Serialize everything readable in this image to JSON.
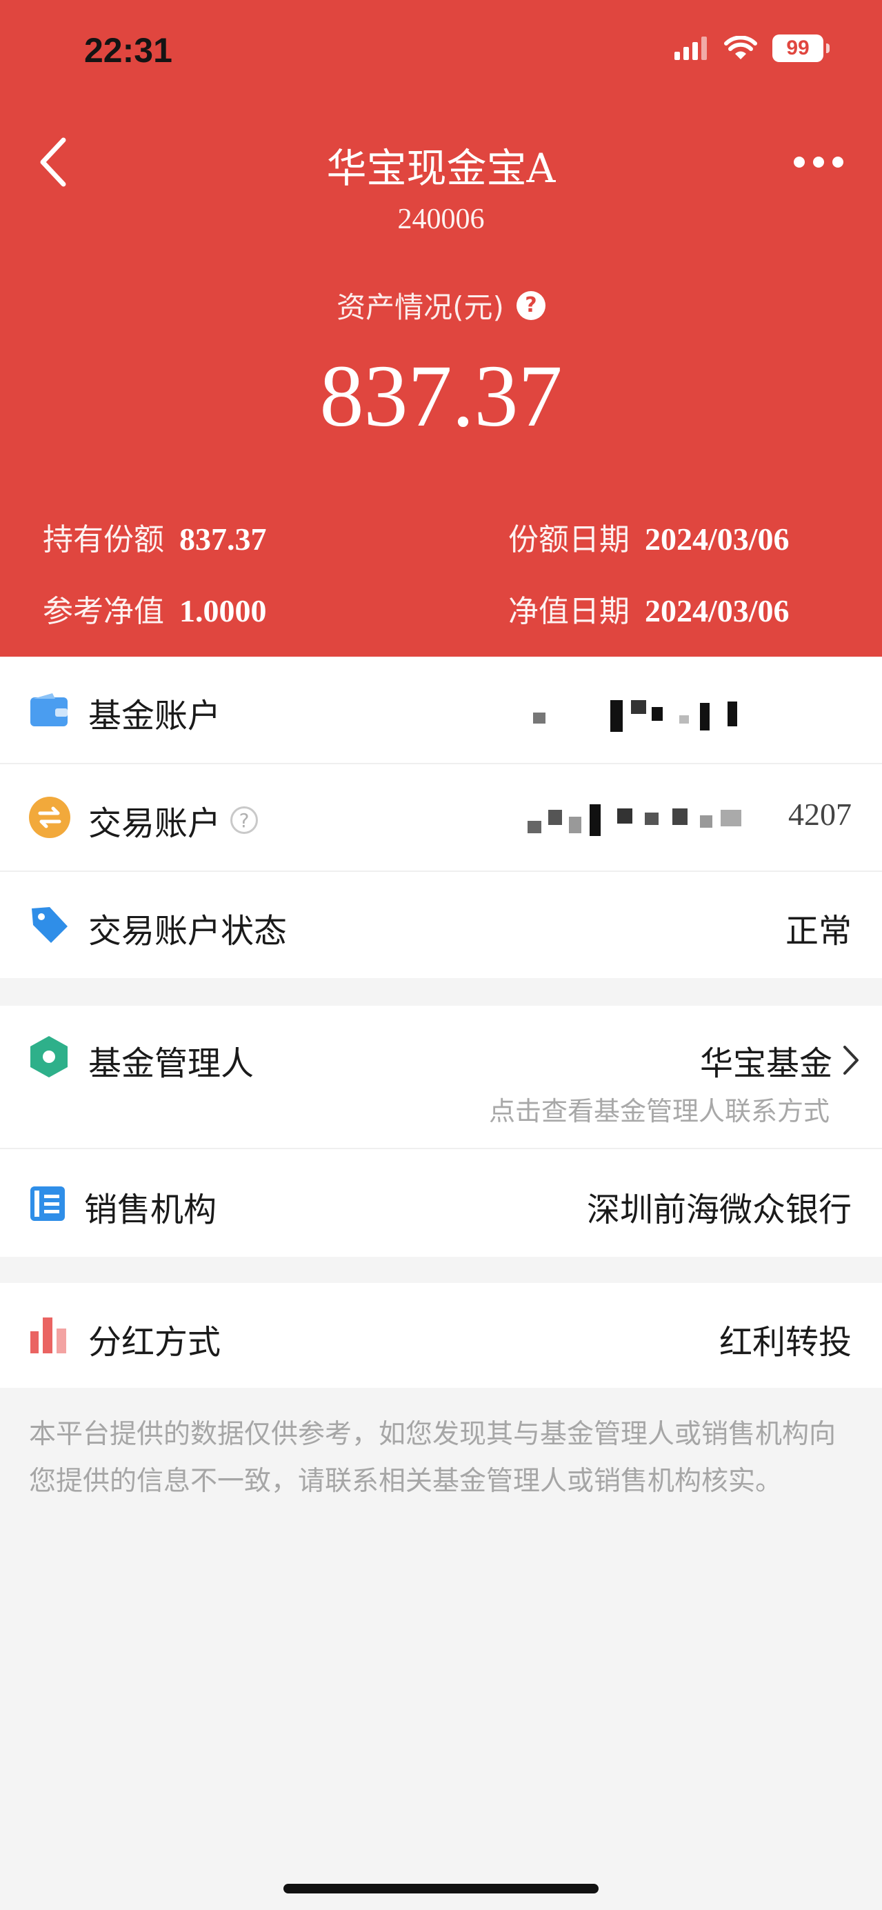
{
  "status_bar": {
    "time": "22:31",
    "battery": "99"
  },
  "header": {
    "fund_name": "华宝现金宝A",
    "fund_code": "240006",
    "asset_label": "资产情况(元)",
    "asset_value": "837.37",
    "stats": {
      "shares_label": "持有份额",
      "shares_value": "837.37",
      "shares_date_label": "份额日期",
      "shares_date_value": "2024/03/06",
      "nav_label": "参考净值",
      "nav_value": "1.0000",
      "nav_date_label": "净值日期",
      "nav_date_value": "2024/03/06"
    }
  },
  "account_section": {
    "fund_account_label": "基金账户",
    "trade_account_label": "交易账户",
    "trade_account_tail": "4207",
    "trade_status_label": "交易账户状态",
    "trade_status_value": "正常"
  },
  "manager_section": {
    "manager_label": "基金管理人",
    "manager_value": "华宝基金",
    "manager_contact_link": "点击查看基金管理人联系方式",
    "sales_label": "销售机构",
    "sales_value": "深圳前海微众银行"
  },
  "dividend_section": {
    "dividend_label": "分红方式",
    "dividend_value": "红利转投"
  },
  "disclaimer": "本平台提供的数据仅供参考，如您发现其与基金管理人或销售机构向您提供的信息不一致，请联系相关基金管理人或销售机构核实。",
  "colors": {
    "header_bg": "#e0463f",
    "wallet_icon": "#4a9df0",
    "transfer_icon": "#f2a93b",
    "tag_icon": "#2f8ee8",
    "manager_icon": "#2eb08a",
    "sales_icon": "#2f8ee8",
    "dividend_icon": "#ea6462"
  },
  "icons": [
    "back-icon",
    "more-icon",
    "help-icon",
    "wallet-icon",
    "transfer-icon",
    "tag-icon",
    "hexagon-icon",
    "book-icon",
    "bar-chart-icon",
    "chevron-right-icon"
  ]
}
